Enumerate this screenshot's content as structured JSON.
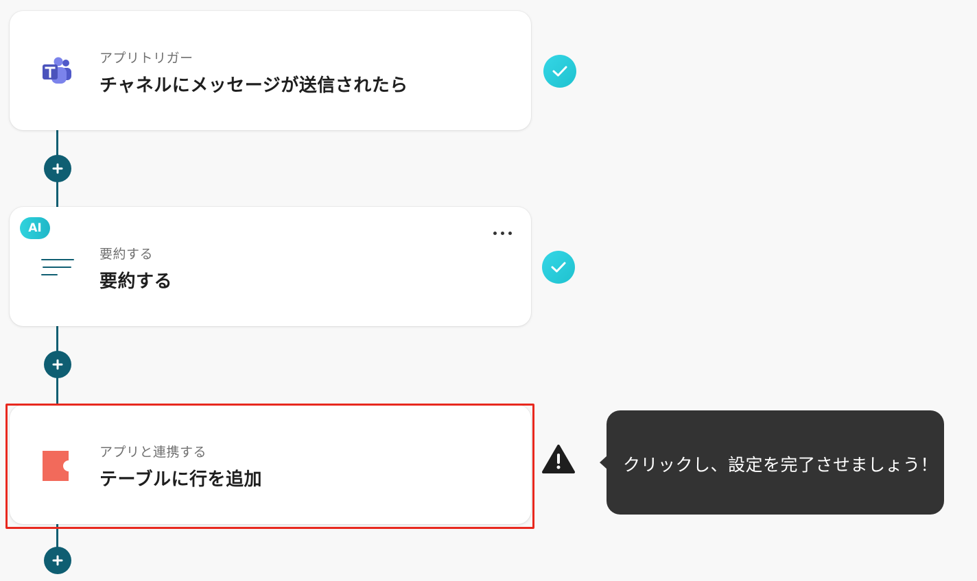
{
  "steps": [
    {
      "subtitle": "アプリトリガー",
      "title": "チャネルにメッセージが送信されたら",
      "icon": "microsoft-teams-icon",
      "status": "complete"
    },
    {
      "badge": "AI",
      "subtitle": "要約する",
      "title": "要約する",
      "icon": "summarize-lines-icon",
      "status": "complete"
    },
    {
      "subtitle": "アプリと連携する",
      "title": "テーブルに行を追加",
      "icon": "coda-icon",
      "status": "warning"
    }
  ],
  "tooltip": {
    "text": "クリックし、設定を完了させましょう！"
  },
  "colors": {
    "connector": "#0f5e72",
    "check": "#28cbd9",
    "highlight": "#e8281e",
    "tooltip_bg": "#333333",
    "coda": "#f26a5b",
    "teams": "#5059c9"
  }
}
